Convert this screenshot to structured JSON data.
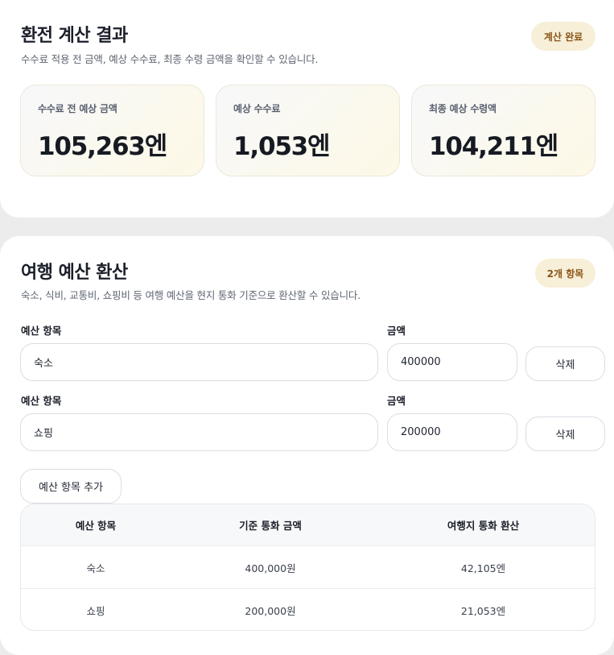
{
  "result_section": {
    "title": "환전 계산 결과",
    "subtitle": "수수료 적용 전 금액, 예상 수수료, 최종 수령 금액을 확인할 수 있습니다.",
    "badge": "계산 완료",
    "stats": [
      {
        "label": "수수료 전 예상 금액",
        "value": "105,263엔"
      },
      {
        "label": "예상 수수료",
        "value": "1,053엔"
      },
      {
        "label": "최종 예상 수령액",
        "value": "104,211엔"
      }
    ]
  },
  "budget_section": {
    "title": "여행 예산 환산",
    "subtitle": "숙소, 식비, 교통비, 쇼핑비 등 여행 예산을 현지 통화 기준으로 환산할 수 있습니다.",
    "badge": "2개 항목",
    "item_label": "예산 항목",
    "amount_label": "금액",
    "delete_label": "삭제",
    "add_button": "예산 항목 추가",
    "rows": [
      {
        "item": "숙소",
        "amount": "400000"
      },
      {
        "item": "쇼핑",
        "amount": "200000"
      }
    ],
    "table": {
      "headers": [
        "예산 항목",
        "기준 통화 금액",
        "여행지 통화 환산"
      ],
      "rows": [
        [
          "숙소",
          "400,000원",
          "42,105엔"
        ],
        [
          "쇼핑",
          "200,000원",
          "21,053엔"
        ]
      ]
    }
  }
}
